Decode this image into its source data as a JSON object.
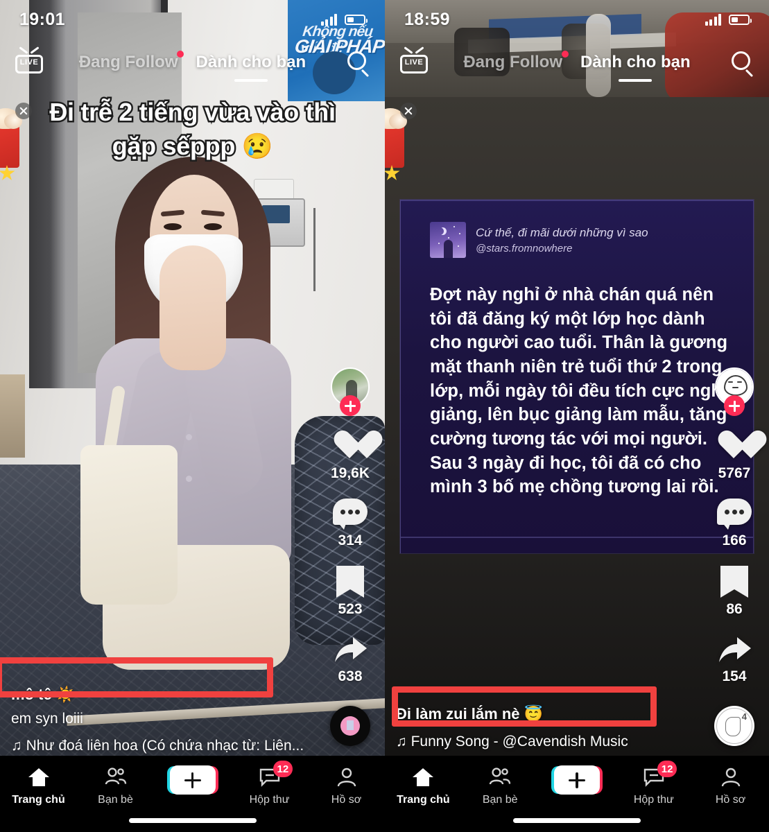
{
  "left_phone": {
    "status": {
      "time": "19:01",
      "signal_icon": "cellular-signal-icon",
      "battery_icon": "battery-icon"
    },
    "top": {
      "live_label": "LIVE",
      "tabs": [
        {
          "label": "Đang Follow",
          "active": false,
          "has_dot": true
        },
        {
          "label": "Dành cho bạn",
          "active": true,
          "has_dot": false
        }
      ],
      "search_icon": "search-icon",
      "close_icon": "close-icon",
      "gift_icon": "gift-icon"
    },
    "overlay_text": "Đi trễ 2 tiếng vừa vào thì gặp sếppp 😢",
    "caption": {
      "main": "mô tê ☀️",
      "sub": "em syn loiii",
      "music": "♫ Như đoá liên hoa (Có chứa nhạc từ: Liên..."
    },
    "actions": {
      "avatar_icon": "profile-avatar",
      "follow_icon": "plus-follow-icon",
      "like": {
        "icon": "heart-icon",
        "count": "19,6K"
      },
      "comment": {
        "icon": "comment-icon",
        "count": "314"
      },
      "bookmark": {
        "icon": "bookmark-icon",
        "count": "523"
      },
      "share": {
        "icon": "share-arrow-icon",
        "count": "638"
      },
      "music_disc_icon": "music-disc-icon"
    },
    "highlight_color": "#f0413f"
  },
  "right_phone": {
    "status": {
      "time": "18:59",
      "signal_icon": "cellular-signal-icon",
      "battery_icon": "battery-icon"
    },
    "top": {
      "live_label": "LIVE",
      "tabs": [
        {
          "label": "Đang Follow",
          "active": false,
          "has_dot": true
        },
        {
          "label": "Dành cho bạn",
          "active": true,
          "has_dot": false
        }
      ],
      "search_icon": "search-icon",
      "close_icon": "close-icon",
      "gift_icon": "gift-icon"
    },
    "card": {
      "thumb_icon": "night-sky-thumbnail",
      "title": "Cứ thế, đi mãi dưới những vì sao",
      "handle": "@stars.fromnowhere",
      "body": "Đợt này nghỉ ở nhà chán quá nên tôi đã đăng ký một lớp học dành cho người cao tuổi. Thân là gương mặt thanh niên trẻ tuổi thứ 2 trong lớp, mỗi ngày tôi đều tích cực nghe giảng, lên bục giảng làm mẫu, tăng cường tương tác với mọi người. Sau 3 ngày đi học, tôi đã có cho mình 3 bố mẹ chồng tương lai rồi."
    },
    "caption": {
      "main": "Đi làm zui lắm nè 😇",
      "music": "♫ Funny Song - @Cavendish Music"
    },
    "actions": {
      "avatar_icon": "profile-avatar",
      "follow_icon": "plus-follow-icon",
      "like": {
        "icon": "heart-icon",
        "count": "5767"
      },
      "comment": {
        "icon": "comment-icon",
        "count": "166"
      },
      "bookmark": {
        "icon": "bookmark-icon",
        "count": "86"
      },
      "share": {
        "icon": "share-arrow-icon",
        "count": "154"
      },
      "music_disc_icon": "music-disc-icon"
    },
    "highlight_color": "#f0413f"
  },
  "bottom_nav": {
    "items": [
      {
        "label": "Trang chủ",
        "icon": "home-icon",
        "active": true,
        "badge": ""
      },
      {
        "label": "Bạn bè",
        "icon": "friends-icon",
        "active": false,
        "badge": ""
      },
      {
        "label": "",
        "icon": "create-plus-icon",
        "active": false,
        "badge": ""
      },
      {
        "label": "Hộp thư",
        "icon": "inbox-icon",
        "active": false,
        "badge": "12"
      },
      {
        "label": "Hồ sơ",
        "icon": "profile-icon",
        "active": false,
        "badge": ""
      }
    ]
  }
}
